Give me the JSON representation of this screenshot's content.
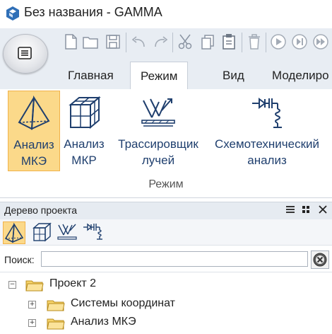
{
  "window": {
    "title": "Без названия - GAMMA"
  },
  "tabs": [
    {
      "label": "Главная",
      "active": false
    },
    {
      "label": "Режим",
      "active": true
    },
    {
      "label": "Вид",
      "active": false
    },
    {
      "label": "Моделиро",
      "active": false
    }
  ],
  "quick_access": [
    "new-file-icon",
    "open-folder-icon",
    "save-icon",
    "undo-icon",
    "redo-icon",
    "cut-icon",
    "copy-icon",
    "paste-icon",
    "delete-icon",
    "play-icon",
    "step-forward-icon",
    "fast-forward-icon"
  ],
  "ribbon": {
    "buttons": [
      {
        "line1": "Анализ",
        "line2": "МКЭ",
        "icon": "pyramid-icon",
        "active": true
      },
      {
        "line1": "Анализ",
        "line2": "МКР",
        "icon": "cube-grid-icon",
        "active": false
      },
      {
        "line1": "Трассировщик",
        "line2": "лучей",
        "icon": "ray-tracer-icon",
        "active": false
      },
      {
        "line1": "Схемотехнический",
        "line2": "анализ",
        "icon": "circuit-icon",
        "active": false
      }
    ],
    "group_label": "Режим"
  },
  "project_panel": {
    "title": "Дерево проекта",
    "search": {
      "label": "Поиск:",
      "value": "",
      "placeholder": ""
    },
    "tree": [
      {
        "label": "Проект 2",
        "expander": "−",
        "level": 0
      },
      {
        "label": "Системы координат",
        "expander": "+",
        "level": 1
      },
      {
        "label": "Анализ МКЭ",
        "expander": "+",
        "level": 1
      }
    ]
  },
  "colors": {
    "accent": "#fbd98a",
    "accent_border": "#f1b24a",
    "ribbon_bg": "#e8edf3",
    "icon_blue": "#1f3f6e",
    "folder": "#f6d36a"
  }
}
